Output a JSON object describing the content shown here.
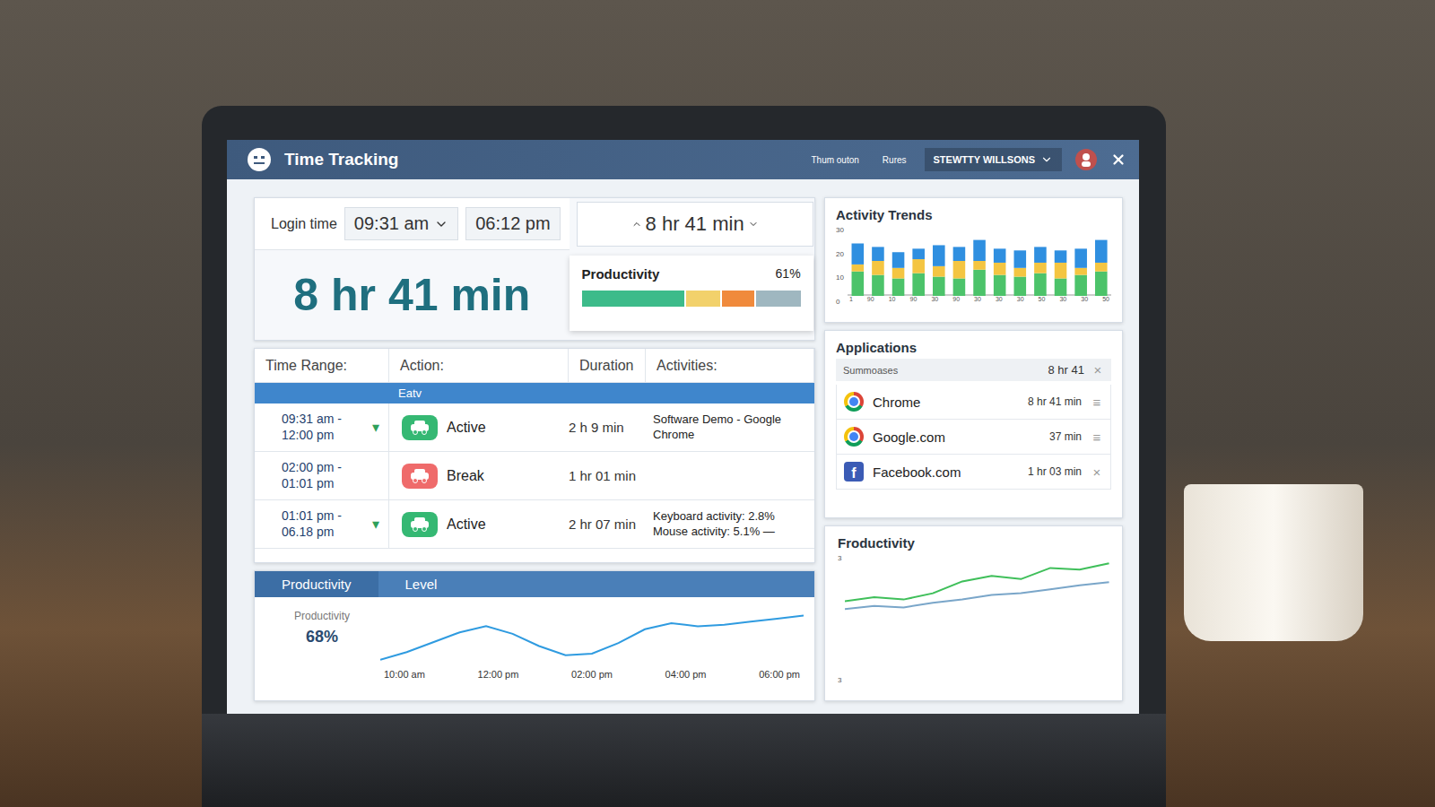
{
  "window": {
    "title": "Time Tracking"
  },
  "header": {
    "nav": [
      "Thum outon",
      "Rures"
    ],
    "user": "STEWTTY WILLSONS"
  },
  "login": {
    "label": "Login time",
    "start": "09:31 am",
    "end": "06:12 pm",
    "total": "8 hr 41 min"
  },
  "total": "8 hr 41 min",
  "productivity": {
    "label": "Productivity",
    "value": "61%",
    "segments": [
      {
        "level": 0.48,
        "color": "#3dbb8a"
      },
      {
        "level": 0.16,
        "color": "#f2d16b"
      },
      {
        "level": 0.15,
        "color": "#f08a3c"
      },
      {
        "level": 0.21,
        "color": "#9fb7c0"
      }
    ]
  },
  "activity_trends": {
    "title": "Activity Trends",
    "y_ticks": [
      "30",
      "20",
      "10",
      "0"
    ],
    "x_ticks": [
      "1",
      "90",
      "10",
      "90",
      "30",
      "90",
      "30",
      "30",
      "30",
      "50",
      "30",
      "30",
      "50"
    ],
    "series": [
      {
        "name": "green",
        "color": "#4cc36a",
        "values": [
          14,
          12,
          10,
          13,
          11,
          10,
          15,
          12,
          11,
          13,
          10,
          12,
          14
        ]
      },
      {
        "name": "yellow",
        "color": "#f4c542",
        "values": [
          4,
          8,
          6,
          8,
          6,
          10,
          5,
          7,
          5,
          6,
          9,
          4,
          5
        ]
      },
      {
        "name": "blue",
        "color": "#2f8fe0",
        "values": [
          12,
          8,
          9,
          6,
          12,
          8,
          12,
          8,
          10,
          9,
          7,
          11,
          13
        ]
      }
    ]
  },
  "table": {
    "columns": [
      "Time Range:",
      "Action:",
      "Duration",
      "Activities:"
    ],
    "group": "Eatv",
    "rows": [
      {
        "range_start": "09:31 am -",
        "range_end": "12:00 pm",
        "expanded": true,
        "toggle": "▾",
        "action": "Active",
        "color": "#35b873",
        "duration": "2 h 9 min",
        "activities": [
          "Software Demo - Google Chrome"
        ]
      },
      {
        "range_start": "02:00 pm -",
        "range_end": "01:01 pm",
        "expanded": false,
        "toggle": "",
        "action": "Break",
        "color": "#ef6b6b",
        "duration": "1 hr 01 min",
        "activities": []
      },
      {
        "range_start": "01:01 pm -",
        "range_end": "06.18 pm",
        "expanded": true,
        "toggle": "▾",
        "action": "Active",
        "color": "#35b873",
        "duration": "2 hr 07 min",
        "activities": [
          "Keyboard activity: 2.8%",
          "Mouse activity: 5.1% —"
        ]
      }
    ]
  },
  "productivity_level": {
    "tabs": [
      "Productivity",
      "Level"
    ],
    "stat_label": "Productivity",
    "stat_value": "68%",
    "x_ticks": [
      "10:00 am",
      "12:00 pm",
      "02:00 pm",
      "04:00 pm",
      "06:00 pm"
    ],
    "values": [
      12,
      22,
      35,
      48,
      56,
      46,
      30,
      18,
      20,
      34,
      52,
      60,
      56,
      58,
      62,
      66,
      70
    ]
  },
  "applications": {
    "title": "Applications",
    "summary": {
      "label": "Summoases",
      "value": "8 hr 41",
      "mark": "×"
    },
    "items": [
      {
        "name": "Chrome",
        "kind": "chrome",
        "icon_text": "",
        "duration": "8 hr 41 min",
        "mark": "≡"
      },
      {
        "name": "Google.com",
        "kind": "chrome",
        "icon_text": "",
        "duration": "37 min",
        "mark": "≡"
      },
      {
        "name": "Facebook.com",
        "kind": "facebook",
        "icon_text": "f",
        "duration": "1 hr 03 min",
        "mark": "×"
      }
    ]
  },
  "small_productivity": {
    "title": "Froductivity",
    "y_ticks": [
      "3",
      "3"
    ],
    "series": [
      {
        "color": "#3fbf5a",
        "values": [
          20,
          25,
          22,
          30,
          45,
          52,
          48,
          62,
          60,
          68
        ]
      },
      {
        "color": "#7aa6c9",
        "values": [
          10,
          14,
          12,
          18,
          22,
          28,
          30,
          35,
          40,
          44
        ]
      }
    ]
  }
}
